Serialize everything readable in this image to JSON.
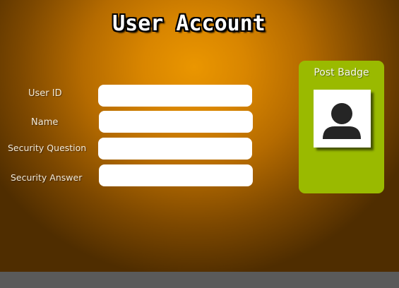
{
  "window": {
    "title": "User Account"
  },
  "form": {
    "fields": [
      {
        "label": "User ID",
        "value": ""
      },
      {
        "label": "Name",
        "value": ""
      },
      {
        "label": "Security Question",
        "value": ""
      },
      {
        "label": "Security Answer",
        "value": ""
      }
    ]
  },
  "badge": {
    "title": "Post Badge",
    "photo_icon": "user-silhouette-icon"
  },
  "colors": {
    "background_center": "#ea9600",
    "background_edge": "#4f2d00",
    "badge_panel": "#9aba00",
    "bottom_bar": "#5a5a5a"
  }
}
